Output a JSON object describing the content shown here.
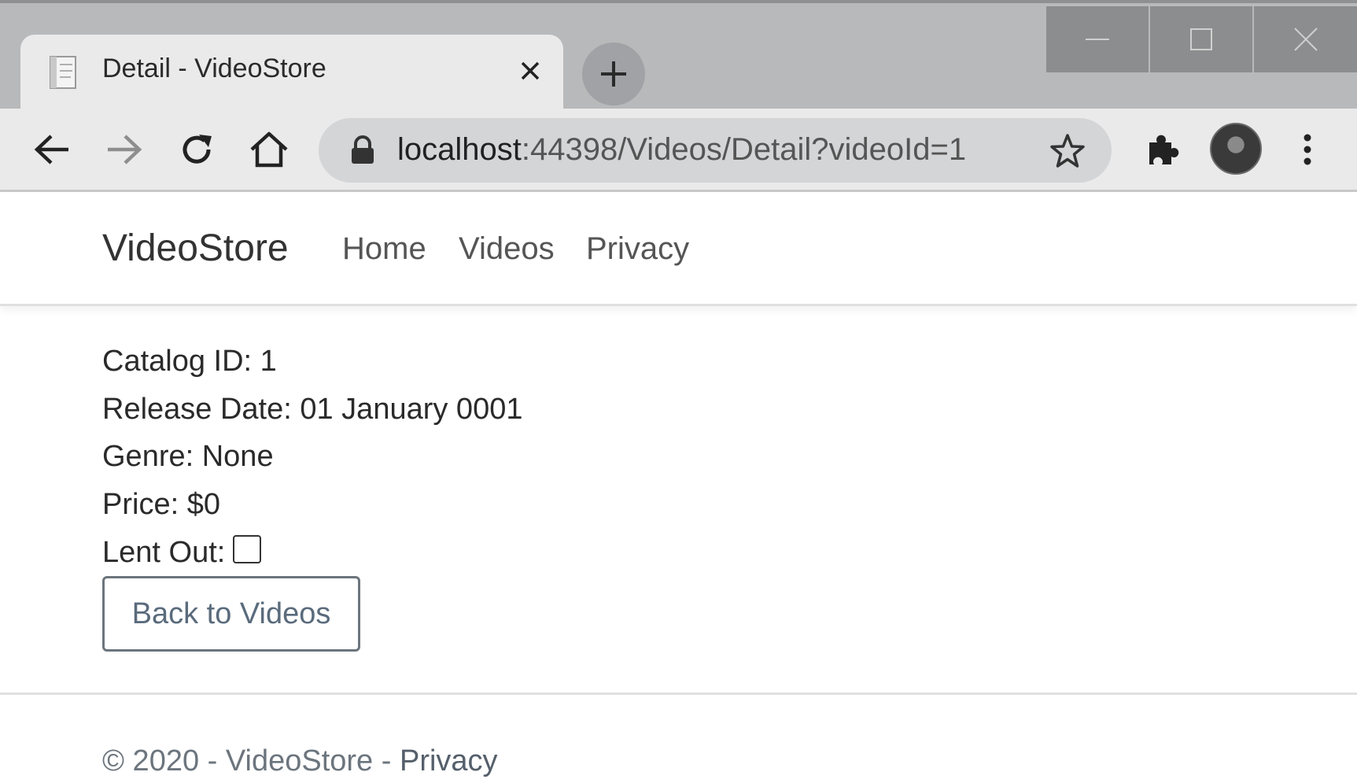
{
  "browser": {
    "tab_title": "Detail - VideoStore",
    "url_host": "localhost",
    "url_rest": ":44398/Videos/Detail?videoId=1",
    "icons": {
      "favicon": "page-icon",
      "tab_close": "close-icon",
      "new_tab": "plus-icon",
      "minimize": "minimize-icon",
      "maximize": "maximize-icon",
      "close": "close-icon",
      "back": "arrow-left-icon",
      "forward": "arrow-right-icon",
      "reload": "reload-icon",
      "home": "home-icon",
      "lock": "lock-icon",
      "bookmark": "star-icon",
      "extensions": "puzzle-icon",
      "profile": "avatar",
      "menu": "kebab-menu-icon"
    }
  },
  "navbar": {
    "brand": "VideoStore",
    "links": [
      "Home",
      "Videos",
      "Privacy"
    ]
  },
  "detail": {
    "catalog_id": "Catalog ID: 1",
    "release_date": "Release Date: 01 January 0001",
    "genre": "Genre: None",
    "price": "Price: $0",
    "lent_out_label": "Lent Out:",
    "lent_out_checked": false,
    "back_button": "Back to Videos"
  },
  "footer": {
    "copyright": "© 2020 - VideoStore - ",
    "privacy_link": "Privacy"
  }
}
